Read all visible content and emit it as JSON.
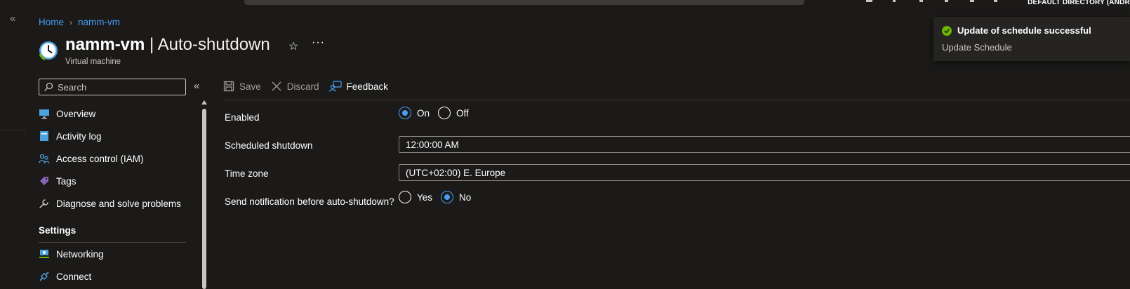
{
  "topbar": {
    "directory_label": "DEFAULT DIRECTORY (ANDR"
  },
  "breadcrumb": {
    "items": [
      "Home",
      "namm-vm"
    ],
    "separator": "›"
  },
  "header": {
    "resource_name": "namm-vm",
    "separator": " | ",
    "page_name": "Auto-shutdown",
    "subtitle": "Virtual machine",
    "more_label": "···"
  },
  "sidebar": {
    "search_placeholder": "Search",
    "collapse_label": "«",
    "items": [
      {
        "label": "Overview",
        "icon": "monitor-icon"
      },
      {
        "label": "Activity log",
        "icon": "activity-log-icon"
      },
      {
        "label": "Access control (IAM)",
        "icon": "people-icon"
      },
      {
        "label": "Tags",
        "icon": "tag-icon"
      },
      {
        "label": "Diagnose and solve problems",
        "icon": "wrench-icon"
      }
    ],
    "section_title": "Settings",
    "settings_items": [
      {
        "label": "Networking",
        "icon": "networking-icon"
      },
      {
        "label": "Connect",
        "icon": "connect-icon"
      }
    ]
  },
  "toolbar": {
    "save_label": "Save",
    "discard_label": "Discard",
    "feedback_label": "Feedback"
  },
  "form": {
    "enabled": {
      "label": "Enabled",
      "options": [
        "On",
        "Off"
      ],
      "selected": "On"
    },
    "scheduled_shutdown": {
      "label": "Scheduled shutdown",
      "value": "12:00:00 AM"
    },
    "time_zone": {
      "label": "Time zone",
      "value": "(UTC+02:00) E. Europe"
    },
    "notification": {
      "label": "Send notification before auto-shutdown?",
      "options": [
        "Yes",
        "No"
      ],
      "selected": "No"
    }
  },
  "toast": {
    "title": "Update of schedule successful",
    "message": "Update Schedule",
    "status_color": "#6bb700"
  },
  "colors": {
    "accent": "#479ef5",
    "background": "#1b1a19",
    "text": "#ffffff"
  }
}
